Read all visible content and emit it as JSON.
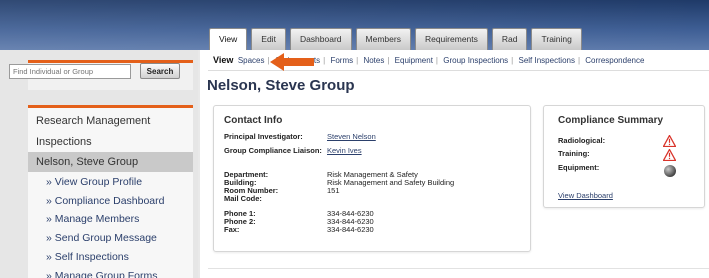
{
  "tabs": [
    "View",
    "Edit",
    "Dashboard",
    "Members",
    "Requirements",
    "Rad",
    "Training"
  ],
  "search": {
    "placeholder": "Find Individual or Group",
    "button": "Search"
  },
  "nav": {
    "main": [
      "Research Management",
      "Inspections",
      "Nelson, Steve Group"
    ],
    "sub": [
      "» View Group Profile",
      "» Compliance Dashboard",
      "» Manage Members",
      "» Send Group Message",
      "» Self Inspections",
      "» Manage Group Forms"
    ]
  },
  "subnav": {
    "current": "View",
    "items": [
      "Spaces",
      "Assignments",
      "Forms",
      "Notes",
      "Equipment",
      "Group Inspections",
      "Self Inspections",
      "Correspondence"
    ]
  },
  "page_title": "Nelson, Steve Group",
  "contact": {
    "title": "Contact Info",
    "pi_label": "Principal Investigator:",
    "pi_value": "Steven Nelson",
    "gcl_label": "Group Compliance Liaison:",
    "gcl_value": "Kevin Ives",
    "rows": [
      {
        "label": "Department:",
        "value": "Risk Management & Safety"
      },
      {
        "label": "Building:",
        "value": "Risk Management and Safety Building"
      },
      {
        "label": "Room Number:",
        "value": "151"
      },
      {
        "label": "Mail Code:",
        "value": ""
      },
      {
        "label": "Phone 1:",
        "value": "334-844-6230"
      },
      {
        "label": "Phone 2:",
        "value": "334-844-6230"
      },
      {
        "label": "Fax:",
        "value": "334-844-6230"
      }
    ]
  },
  "compliance": {
    "title": "Compliance Summary",
    "rows": [
      {
        "label": "Radiological:",
        "icon": "warning-icon"
      },
      {
        "label": "Training:",
        "icon": "warning-icon"
      },
      {
        "label": "Equipment:",
        "icon": "globe-icon"
      }
    ],
    "link": "View Dashboard"
  },
  "colors": {
    "accent": "#e4601a",
    "header": "#2e4d80",
    "link": "#2b3f6b",
    "warning": "#d9342b"
  }
}
